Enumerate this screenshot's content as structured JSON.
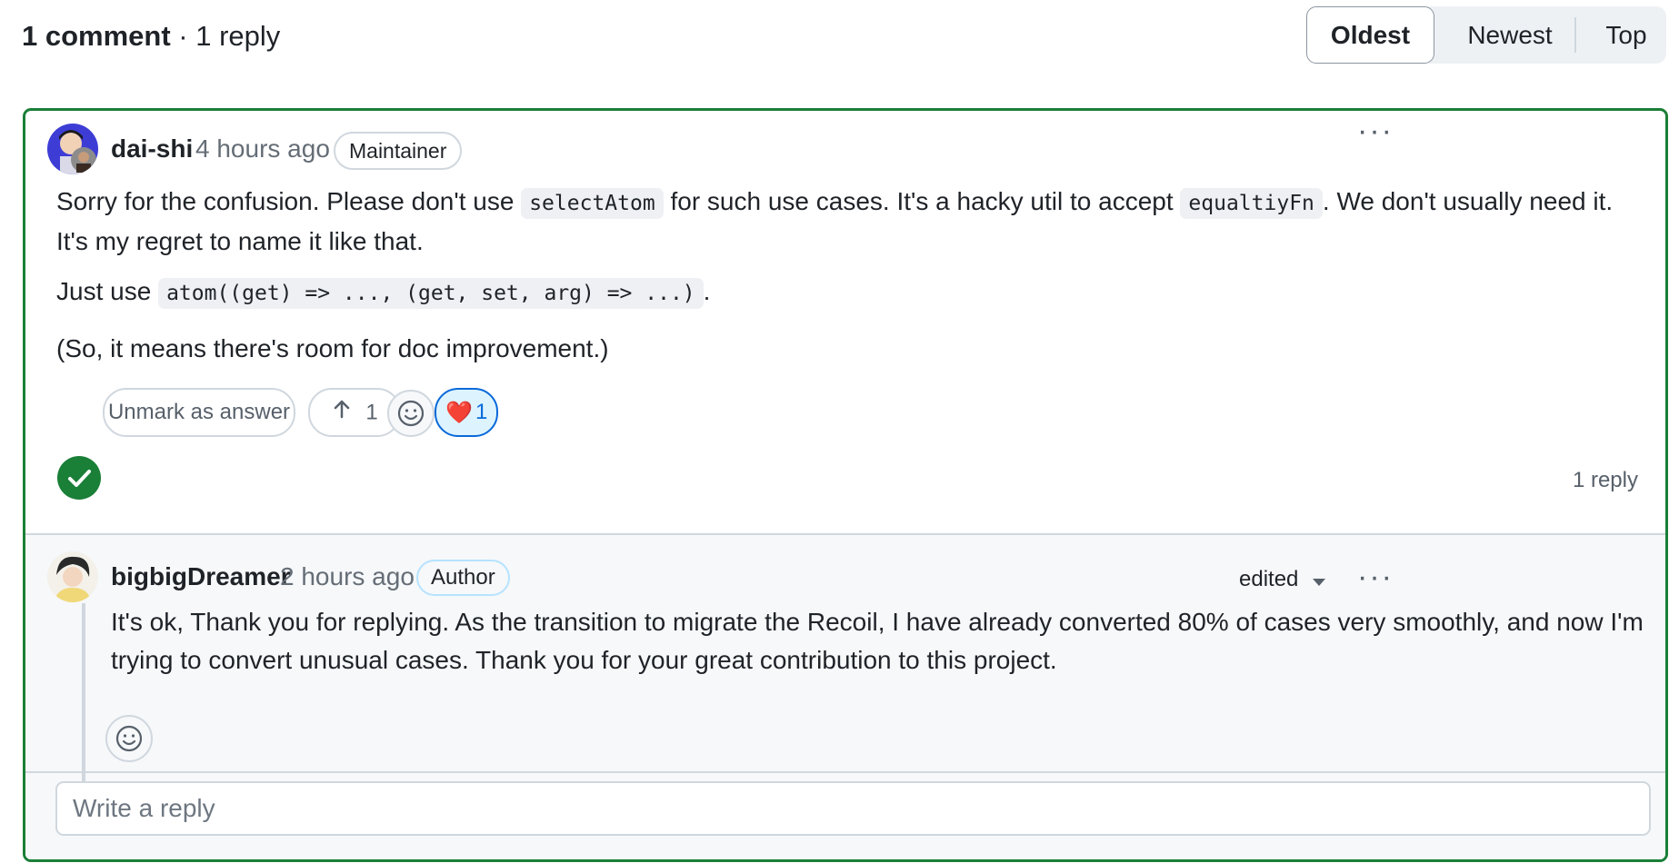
{
  "header": {
    "comment_count": "1 comment",
    "separator": " · ",
    "reply_count": "1 reply",
    "sort_options": [
      "Oldest",
      "Newest",
      "Top"
    ],
    "active_sort": "Oldest"
  },
  "comment": {
    "author": "dai-shi",
    "time": "4 hours ago",
    "role_badge": "Maintainer",
    "body": {
      "p1_a": "Sorry for the confusion. Please don't use ",
      "p1_code1": "selectAtom",
      "p1_b": " for such use cases. It's a hacky util to accept ",
      "p1_code2": "equaltiyFn",
      "p1_c": ". We don't usually need it. It's my regret to name it like that.",
      "p2_a": "Just use ",
      "p2_code": "atom((get) => ..., (get, set, arg) => ...)",
      "p2_b": ".",
      "p3": "(So, it means there's room for doc improvement.)"
    },
    "unmark_label": "Unmark as answer",
    "upvote_count": "1",
    "heart_count": "1",
    "reply_count_label": "1 reply"
  },
  "reply": {
    "author": "bigbigDreamer",
    "time": "2 hours ago",
    "role_badge": "Author",
    "edited_label": "edited",
    "body": "It's ok, Thank you for replying. As the transition to migrate the Recoil, I have already converted 80% of cases very smoothly, and now I'm trying to convert unusual cases. Thank you for your great contribution to this project."
  },
  "reply_box": {
    "placeholder": "Write a reply"
  },
  "colors": {
    "answer_border": "#1a7f37",
    "reaction_active": "#0969da"
  }
}
